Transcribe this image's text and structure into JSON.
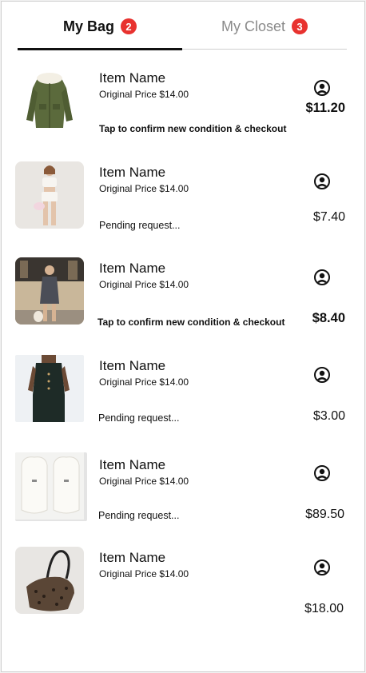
{
  "tabs": {
    "bag": {
      "label": "My Bag",
      "count": "2"
    },
    "closet": {
      "label": "My Closet",
      "count": "3"
    }
  },
  "items": [
    {
      "name": "Item Name",
      "original_price": "Original Price $14.00",
      "status": "Tap to confirm new condition & checkout",
      "price": "$11.20",
      "thumb": "olive parka jacket"
    },
    {
      "name": "Item Name",
      "original_price": "Original Price $14.00",
      "status": "Pending request...",
      "price": "$7.40",
      "thumb": "white two-piece outfit"
    },
    {
      "name": "Item Name",
      "original_price": "Original Price $14.00",
      "status": "Tap to confirm new condition & checkout",
      "price": "$8.40",
      "thumb": "grey mini dress street photo"
    },
    {
      "name": "Item Name",
      "original_price": "Original Price $14.00",
      "status": "Pending request...",
      "price": "$3.00",
      "thumb": "dark green vest set"
    },
    {
      "name": "Item Name",
      "original_price": "Original Price $14.00",
      "status": "Pending request...",
      "price": "$89.50",
      "thumb": "white fleece mittens"
    },
    {
      "name": "Item Name",
      "original_price": "Original Price $14.00",
      "status": "",
      "price": "$18.00",
      "thumb": "leopard print shoulder bag"
    }
  ],
  "icons": {
    "seller": "user-circle-icon"
  },
  "colors": {
    "badge": "#e8322f",
    "active_tab": "#111111",
    "inactive_tab": "#8a8a8a"
  }
}
